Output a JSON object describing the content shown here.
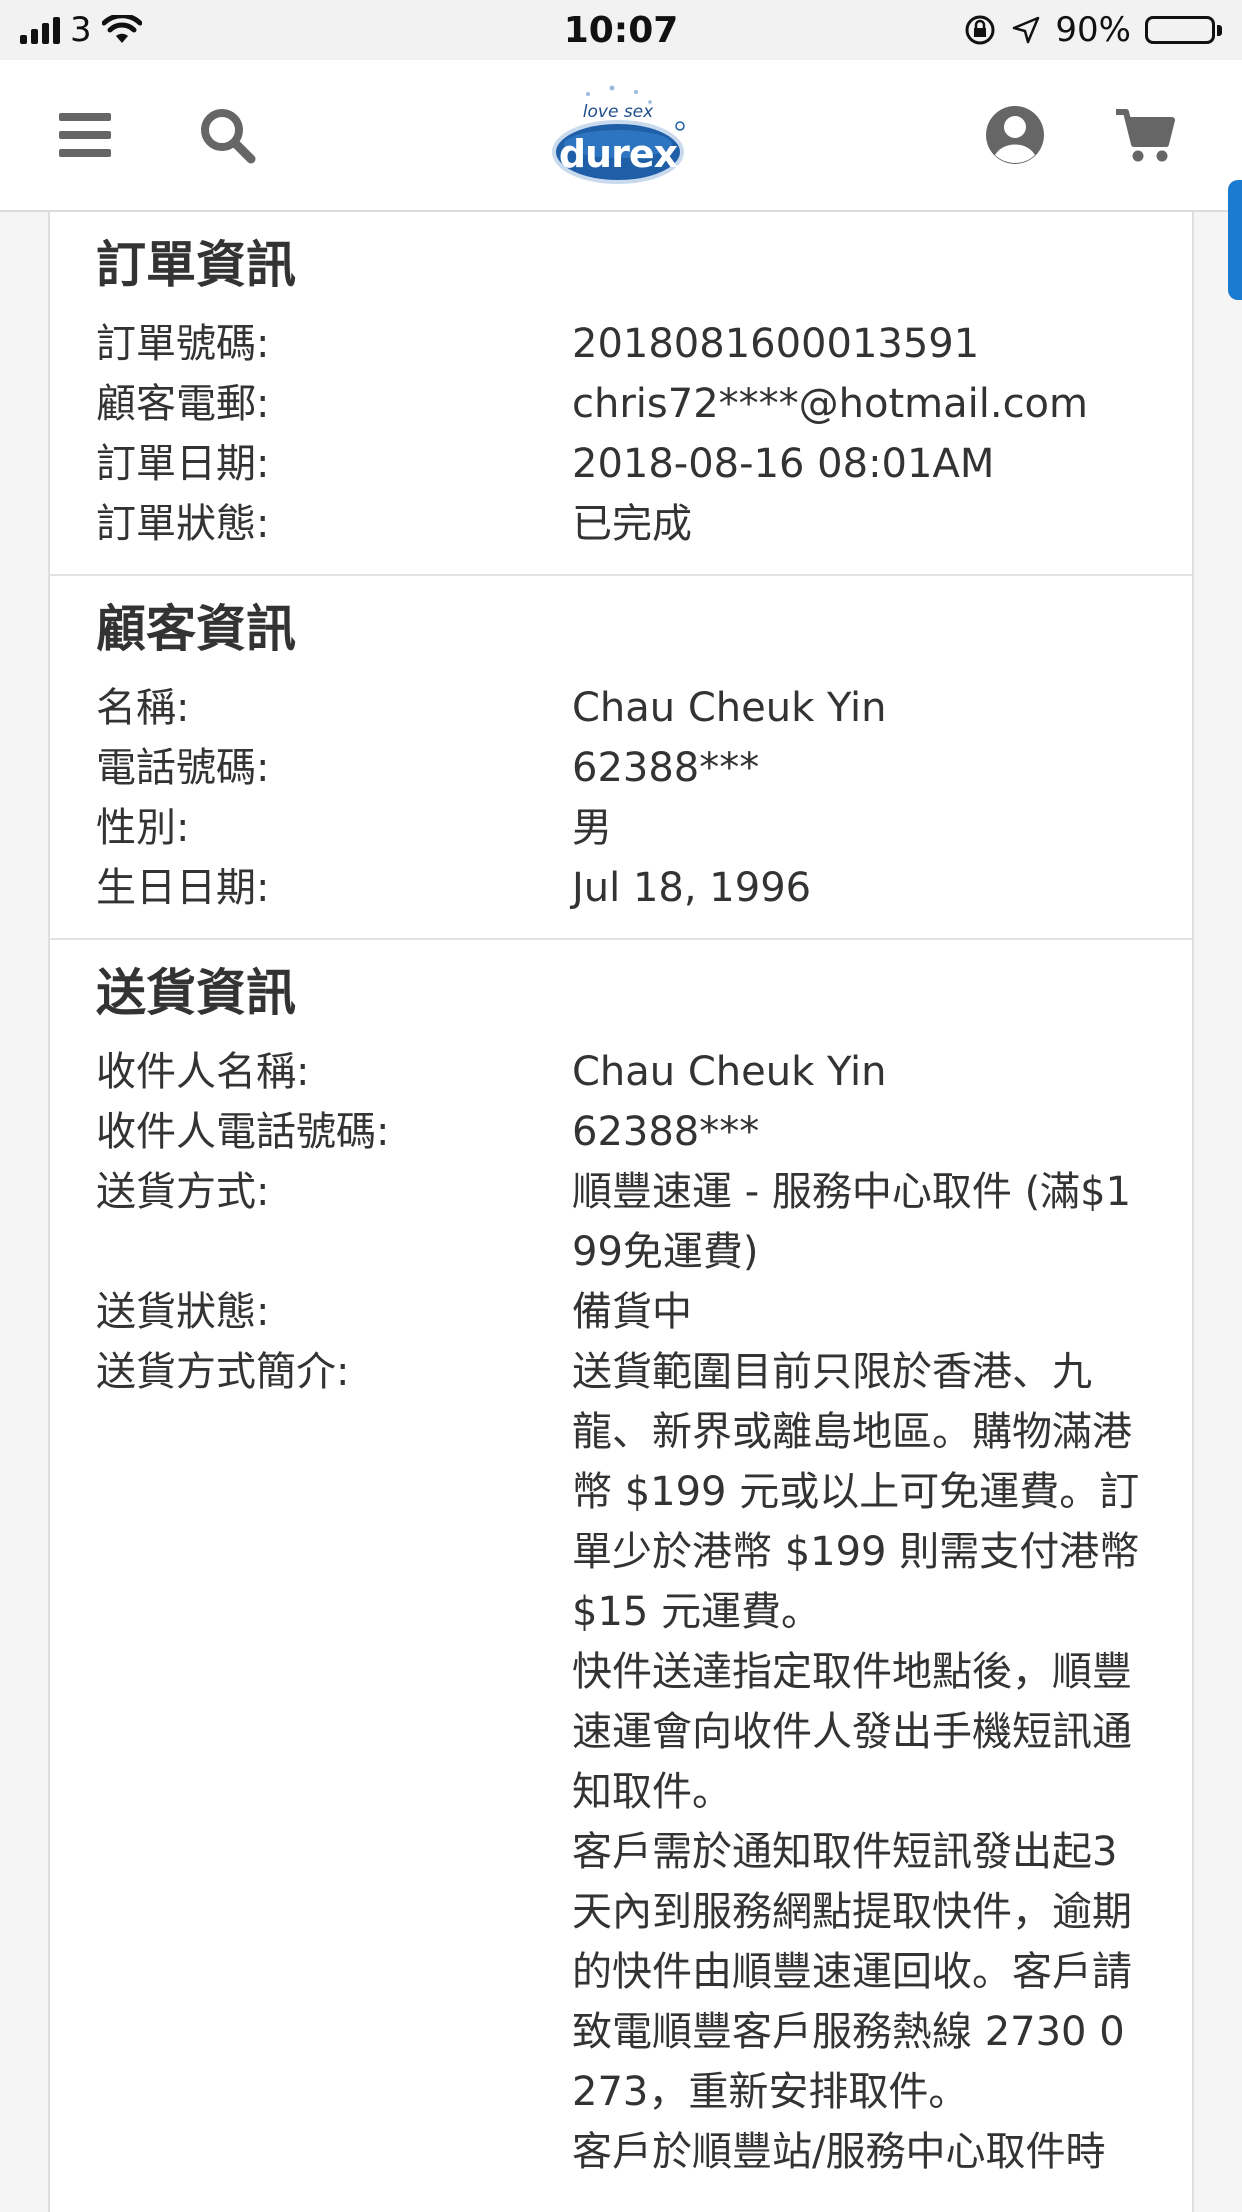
{
  "status_bar": {
    "carrier": "3",
    "time": "10:07",
    "battery": "90%",
    "battery_level": 0.9
  },
  "header": {
    "logo_tagline": "love sex",
    "logo_brand": "durex",
    "icons": [
      "menu-icon",
      "search-icon",
      "account-icon",
      "cart-icon"
    ]
  },
  "order_info": {
    "title": "訂單資訊",
    "rows": [
      {
        "label": "訂單號碼:",
        "value": "2018081600013591"
      },
      {
        "label": "顧客電郵:",
        "value": "chris72****@hotmail.com"
      },
      {
        "label": "訂單日期:",
        "value": "2018-08-16 08:01AM"
      },
      {
        "label": "訂單狀態:",
        "value": "已完成"
      }
    ]
  },
  "customer_info": {
    "title": "顧客資訊",
    "rows": [
      {
        "label": "名稱:",
        "value": "Chau Cheuk Yin"
      },
      {
        "label": "電話號碼:",
        "value": "62388***"
      },
      {
        "label": "性別:",
        "value": "男"
      },
      {
        "label": "生日日期:",
        "value": "Jul 18, 1996"
      }
    ]
  },
  "delivery_info": {
    "title": "送貨資訊",
    "rows": [
      {
        "label": "收件人名稱:",
        "value": "Chau Cheuk Yin"
      },
      {
        "label": "收件人電話號碼:",
        "value": "62388***"
      },
      {
        "label": "送貨方式:",
        "value": "順豐速運 - 服務中心取件 (滿$199免運費)"
      },
      {
        "label": "送貨狀態:",
        "value": "備貨中"
      },
      {
        "label": "送貨方式簡介:",
        "value": "送貨範圍目前只限於香港、九龍、新界或離島地區。購物滿港幣 $199 元或以上可免運費。訂單少於港幣 $199 則需支付港幣 $15 元運費。"
      }
    ],
    "description_more": [
      "快件送達指定取件地點後，順豐速運會向收件人發出手機短訊通知取件。",
      "客戶需於通知取件短訊發出起3天內到服務網點提取快件，逾期的快件由順豐速運回收。客戶請致電順豐客戶服務熱線 2730 0273，重新安排取件。",
      "客戶於順豐站/服務中心取件時"
    ]
  },
  "colors": {
    "accent_tab": "#1b7bd0",
    "logo_blue": "#1f5fa8",
    "text": "#333333",
    "icon_gray": "#666666"
  }
}
